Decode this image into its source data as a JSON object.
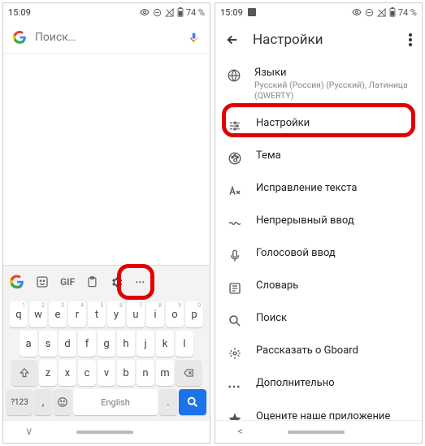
{
  "status": {
    "time": "15:09",
    "battery": "74 %"
  },
  "left": {
    "search_placeholder": "Поиск…",
    "kb": {
      "gif": "GIF",
      "row1": [
        "q",
        "w",
        "e",
        "r",
        "t",
        "y",
        "u",
        "i",
        "o",
        "p"
      ],
      "hints1": [
        "1",
        "2",
        "3",
        "4",
        "5",
        "6",
        "7",
        "8",
        "9",
        "0"
      ],
      "row2": [
        "a",
        "s",
        "d",
        "f",
        "g",
        "h",
        "j",
        "k",
        "l"
      ],
      "row3": [
        "z",
        "x",
        "c",
        "v",
        "b",
        "n",
        "m"
      ],
      "sym": "?123",
      "space": "English",
      "comma": ",",
      "dot": "."
    }
  },
  "right": {
    "title": "Настройки",
    "items": [
      {
        "title": "Языки",
        "sub": "Русский (Россия) (Русский), Латиница (QWERTY)"
      },
      {
        "title": "Настройки"
      },
      {
        "title": "Тема"
      },
      {
        "title": "Исправление текста"
      },
      {
        "title": "Непрерывный ввод"
      },
      {
        "title": "Голосовой ввод"
      },
      {
        "title": "Словарь"
      },
      {
        "title": "Поиск"
      },
      {
        "title": "Рассказать о Gboard"
      },
      {
        "title": "Дополнительно"
      },
      {
        "title": "Оцените наше приложение"
      }
    ]
  }
}
